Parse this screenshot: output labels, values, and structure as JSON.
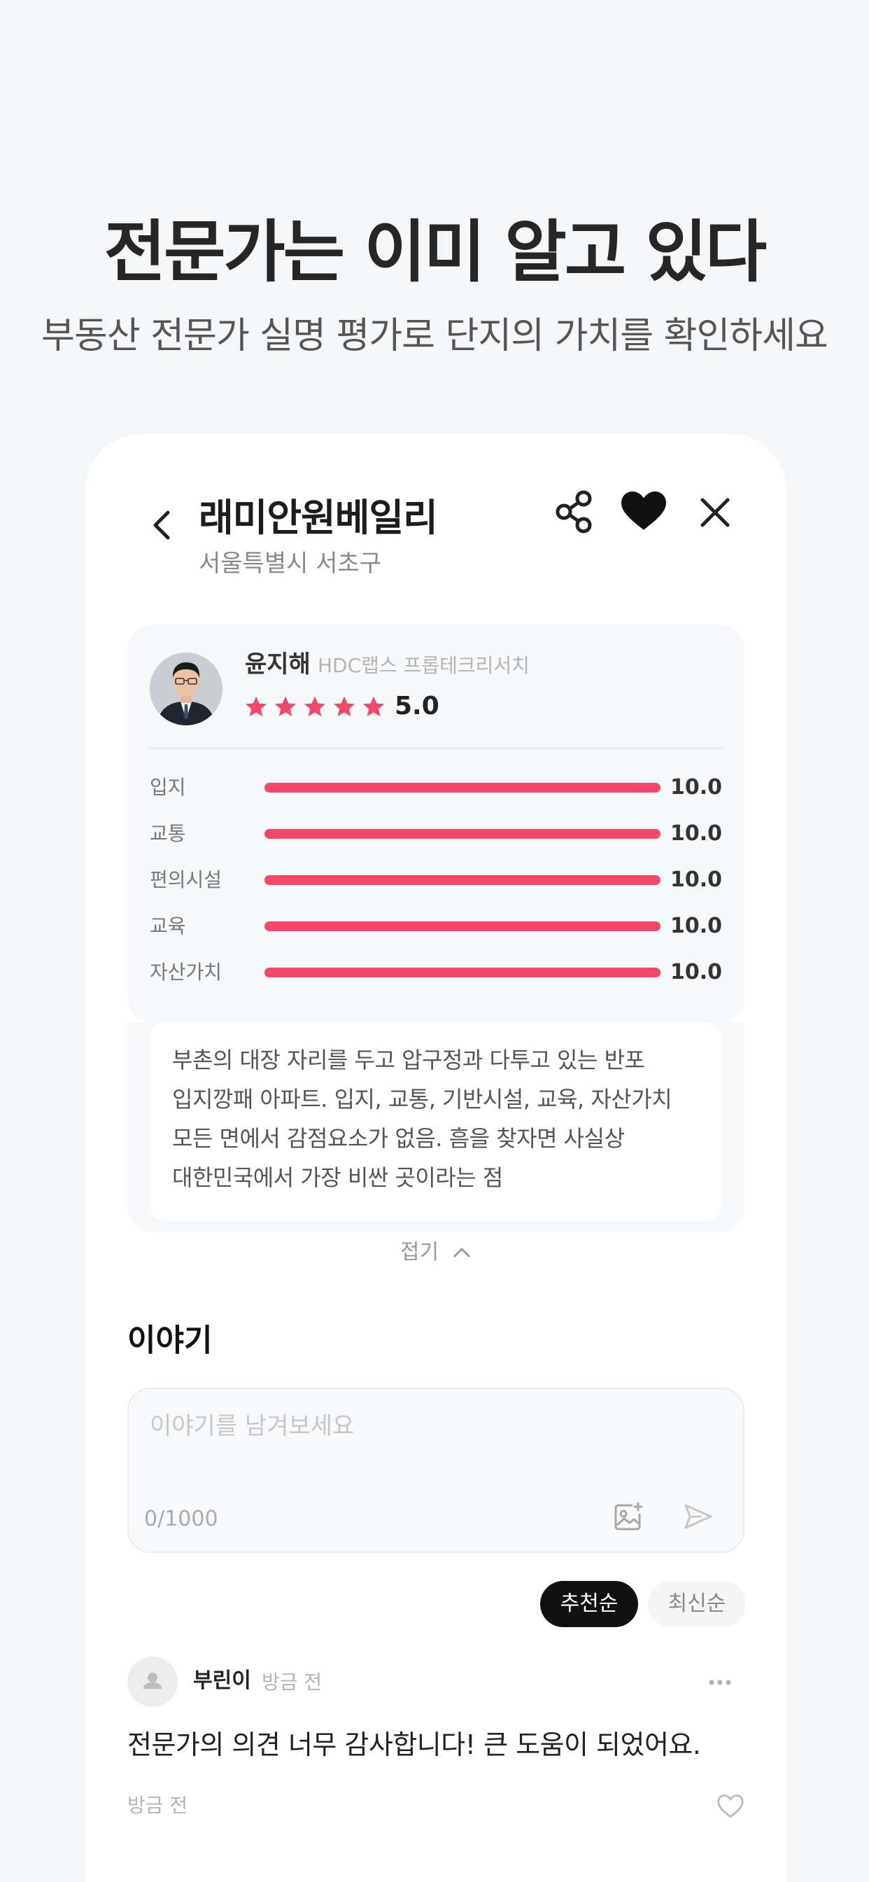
{
  "hero": {
    "title": "전문가는 이미 알고 있다",
    "subtitle": "부동산 전문가 실명 평가로 단지의 가치를 확인하세요"
  },
  "header": {
    "apartment_name": "래미안원베일리",
    "location": "서울특별시 서초구",
    "icons": [
      "back-icon",
      "share-icon",
      "heart-icon",
      "close-icon"
    ]
  },
  "expert_review": {
    "expert_name": "윤지해",
    "expert_company": "HDC랩스 프롭테크리서치",
    "star_count": 5,
    "rating": "5.0",
    "scores": [
      {
        "label": "입지",
        "value": "10.0",
        "fraction": 1.0
      },
      {
        "label": "교통",
        "value": "10.0",
        "fraction": 1.0
      },
      {
        "label": "편의시설",
        "value": "10.0",
        "fraction": 1.0
      },
      {
        "label": "교육",
        "value": "10.0",
        "fraction": 1.0
      },
      {
        "label": "자산가치",
        "value": "10.0",
        "fraction": 1.0
      }
    ],
    "comment": "부촌의 대장 자리를 두고 압구정과 다투고 있는 반포\n입지깡패 아파트. 입지, 교통, 기반시설, 교육, 자산가치\n모든 면에서 감점요소가 없음. 흠을 찾자면 사실상\n대한민국에서 가장 비싼 곳이라는 점",
    "collapse_label": "접기"
  },
  "story": {
    "title": "이야기",
    "placeholder": "이야기를 남겨보세요",
    "char_count": "0/1000",
    "sort_options": [
      "추천순",
      "최신순"
    ],
    "selected_sort": "추천순"
  },
  "comments": [
    {
      "author": "부린이",
      "time_top": "방금 전",
      "body": "전문가의 의견 너무 감사합니다! 큰 도움이 되었어요.",
      "time_bottom": "방금 전"
    }
  ],
  "colors": {
    "accent": "#f4476a",
    "page_background": "#f5f6f8",
    "card_background": "#ffffff",
    "selected_chip": "#111111"
  }
}
